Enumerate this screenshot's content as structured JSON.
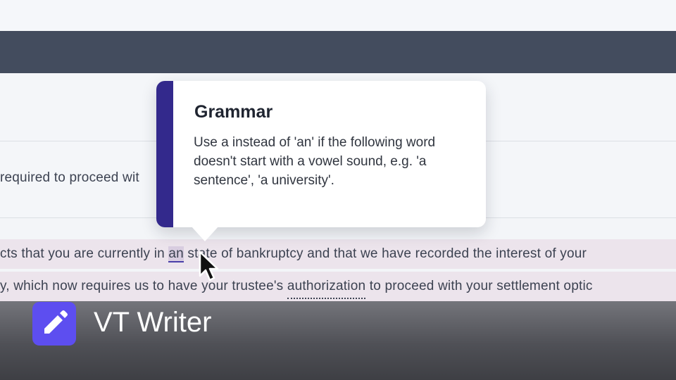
{
  "editor": {
    "line1": "required to proceed wit",
    "line2": {
      "before": "cts that you are currently in ",
      "highlight": "an",
      "after": " state of bankruptcy and that we have recorded the interest of your"
    },
    "line3": {
      "before": "y, which now requires us to have your trustee's ",
      "underlined": "authorization",
      "after": " to proceed with your settlement optic"
    }
  },
  "tooltip": {
    "title": "Grammar",
    "body": "Use a instead of 'an' if the following word doesn't start with a vowel sound, e.g. 'a sentence', 'a university'.",
    "accent_color": "#33298c"
  },
  "brand": {
    "name": "VT Writer",
    "icon": "pencil-icon",
    "badge_color": "#5d4ef0"
  }
}
